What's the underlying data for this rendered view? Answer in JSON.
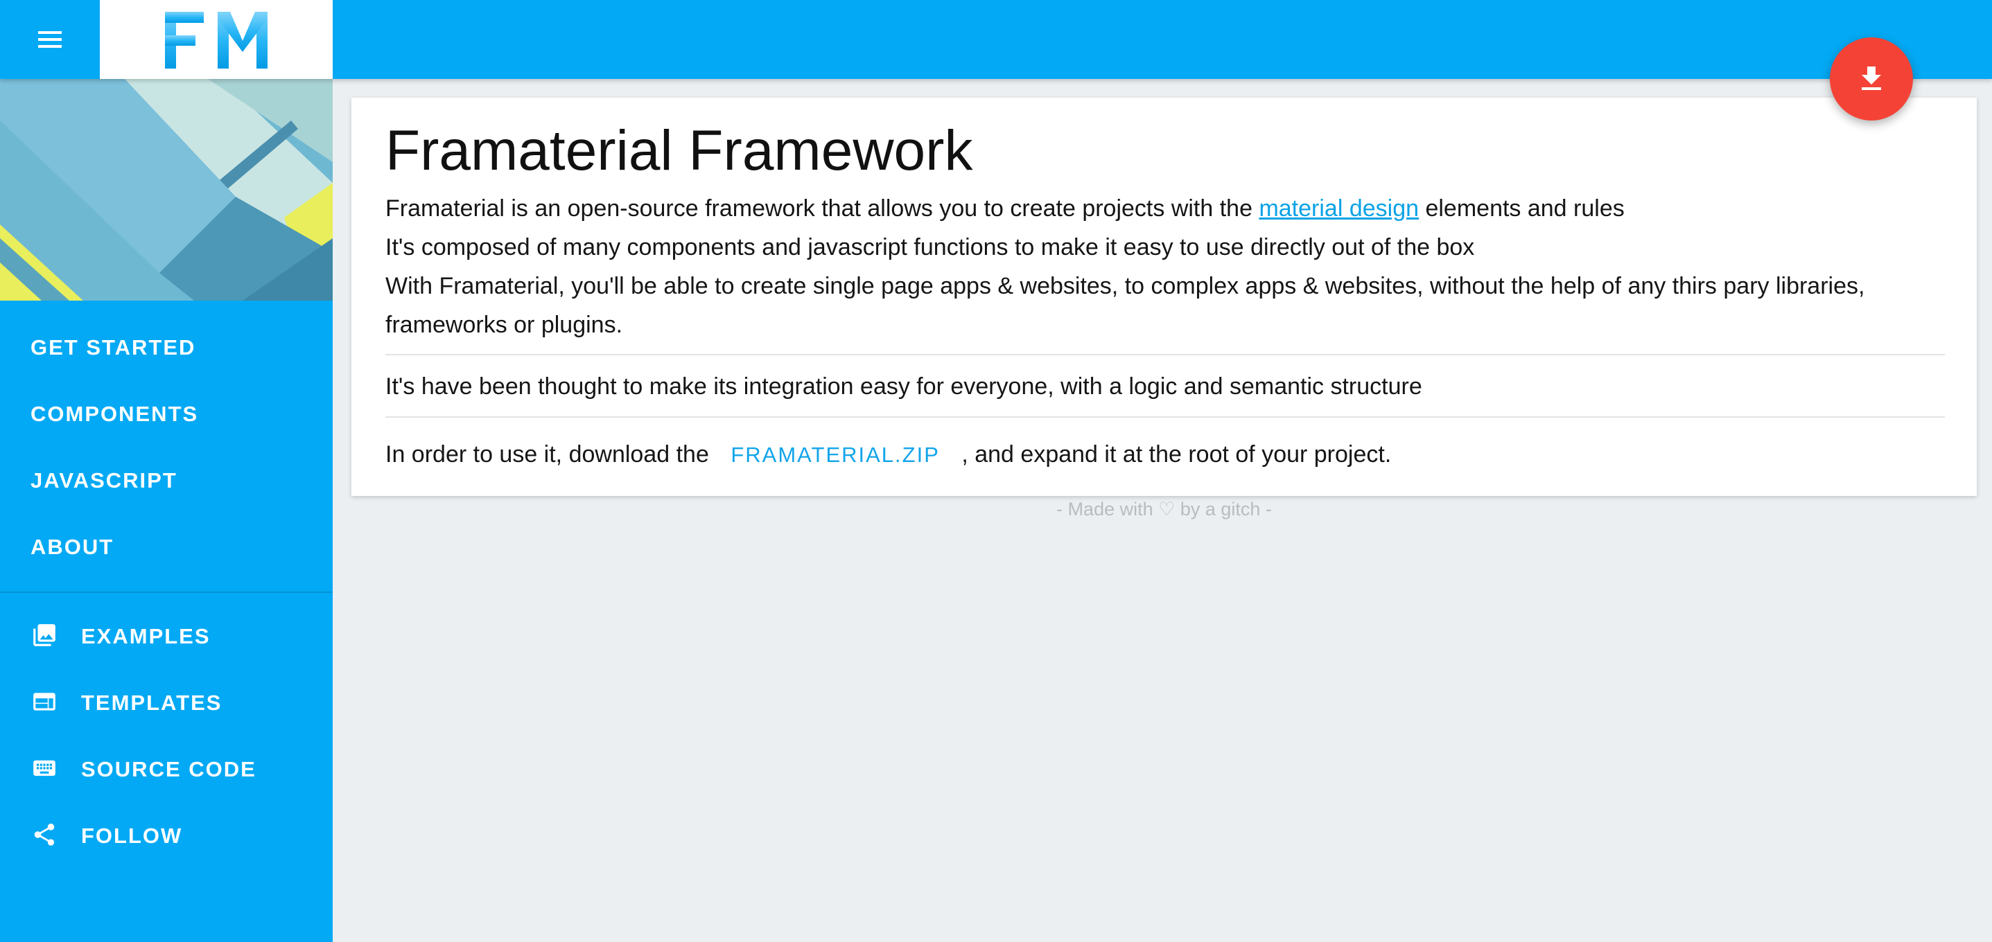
{
  "logo": {
    "text": "FM",
    "color": "#29b6f6"
  },
  "nav": {
    "primary": [
      {
        "label": "GET STARTED"
      },
      {
        "label": "COMPONENTS"
      },
      {
        "label": "JAVASCRIPT"
      },
      {
        "label": "ABOUT"
      }
    ],
    "secondary": [
      {
        "label": "EXAMPLES",
        "icon": "image-gallery-icon"
      },
      {
        "label": "TEMPLATES",
        "icon": "web-template-icon"
      },
      {
        "label": "SOURCE CODE",
        "icon": "keyboard-icon"
      },
      {
        "label": "FOLLOW",
        "icon": "share-icon"
      }
    ]
  },
  "main": {
    "title": "Framaterial Framework",
    "intro_before_link": "Framaterial is an open-source framework that allows you to create projects with the ",
    "intro_link": "material design",
    "intro_after_link": " elements and rules",
    "line2": "It's composed of many components and javascript functions to make it easy to use directly out of the box",
    "line3": "With Framaterial, you'll be able to create single page apps & websites, to complex apps & websites, without the help of any thirs pary libraries, frameworks or plugins.",
    "line4": "It's have been thought to make its integration easy for everyone, with a logic and semantic structure",
    "download_before": "In order to use it, download the ",
    "download_button": "FRAMATERIAL.ZIP",
    "download_after": " , and expand it at the root of your project."
  },
  "footer": {
    "text": "- Made with ♡ by a gitch -"
  },
  "colors": {
    "primary": "#03a9f4",
    "accent": "#f44336",
    "background": "#eceff1"
  }
}
